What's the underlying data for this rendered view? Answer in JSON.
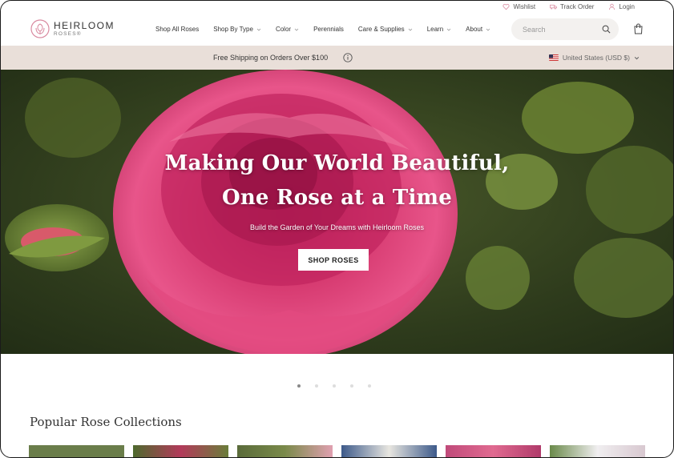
{
  "utility": {
    "wishlist": "Wishlist",
    "track_order": "Track Order",
    "login": "Login"
  },
  "brand": {
    "name_line1": "HEIRLOOM",
    "name_line2": "ROSES®",
    "accent": "#d98aa0"
  },
  "nav": {
    "items": [
      {
        "label": "Shop All Roses",
        "dropdown": false
      },
      {
        "label": "Shop By Type",
        "dropdown": true
      },
      {
        "label": "Color",
        "dropdown": true
      },
      {
        "label": "Perennials",
        "dropdown": false
      },
      {
        "label": "Care & Supplies",
        "dropdown": true
      },
      {
        "label": "Learn",
        "dropdown": true
      },
      {
        "label": "About",
        "dropdown": true
      }
    ]
  },
  "search": {
    "placeholder": "Search"
  },
  "promo": {
    "text": "Free Shipping on Orders Over $100",
    "locale": "United States (USD $)"
  },
  "hero": {
    "headline_line1": "Making Our World Beautiful,",
    "headline_line2": "One Rose at a Time",
    "subtitle": "Build the Garden of Your Dreams with Heirloom Roses",
    "cta": "SHOP ROSES"
  },
  "carousel": {
    "slides": 5,
    "active_index": 0
  },
  "collections": {
    "title": "Popular Rose Collections",
    "thumb_colors": [
      "#6a7d4a",
      "#8a4a5a",
      "#5a6b3a",
      "#3d5a8a",
      "#c04a7a",
      "#e8e4e8"
    ]
  }
}
